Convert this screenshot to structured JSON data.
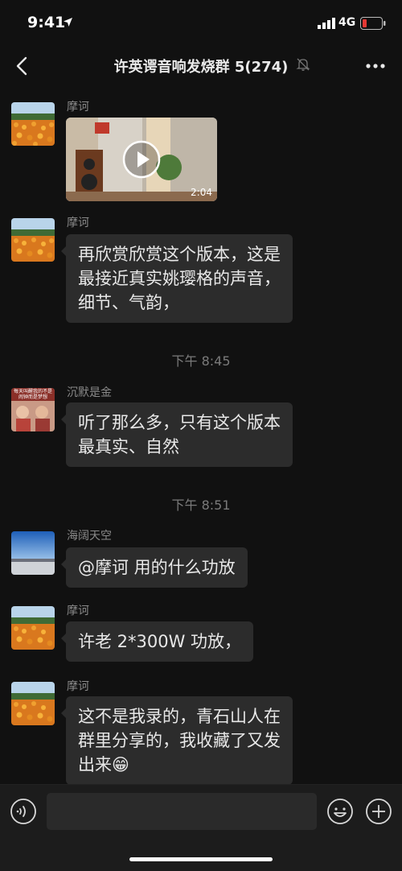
{
  "status": {
    "time": "9:41",
    "network": "4G",
    "battery_color": "#e53935"
  },
  "nav": {
    "title": "许英谔音响发烧群 5(274)"
  },
  "messages": [
    {
      "sender": "摩诃",
      "type": "video",
      "duration": "2:04"
    },
    {
      "sender": "摩诃",
      "type": "text",
      "lines": [
        "再欣赏欣赏这个版本，这是",
        "最接近真实姚璎格的声音，",
        "细节、气韵，"
      ]
    },
    {
      "type": "time",
      "text": "下午 8:45"
    },
    {
      "sender": "沉默是金",
      "type": "text",
      "lines": [
        "听了那么多，只有这个版本",
        "最真实、自然"
      ],
      "avatar_caption": [
        "每天叫醒我的不是",
        "闹钟而是梦想"
      ]
    },
    {
      "type": "time",
      "text": "下午 8:51"
    },
    {
      "sender": "海阔天空",
      "type": "text",
      "lines": [
        "@摩诃 用的什么功放"
      ]
    },
    {
      "sender": "摩诃",
      "type": "text",
      "lines": [
        "许老 2*300W 功放，"
      ]
    },
    {
      "sender": "摩诃",
      "type": "text",
      "lines": [
        "这不是我录的，青石山人在",
        "群里分享的，我收藏了又发",
        "出来😁"
      ]
    }
  ],
  "colors": {
    "background": "#111111",
    "bubble": "#2c2c2c",
    "input_bar": "#1c1c1c"
  }
}
